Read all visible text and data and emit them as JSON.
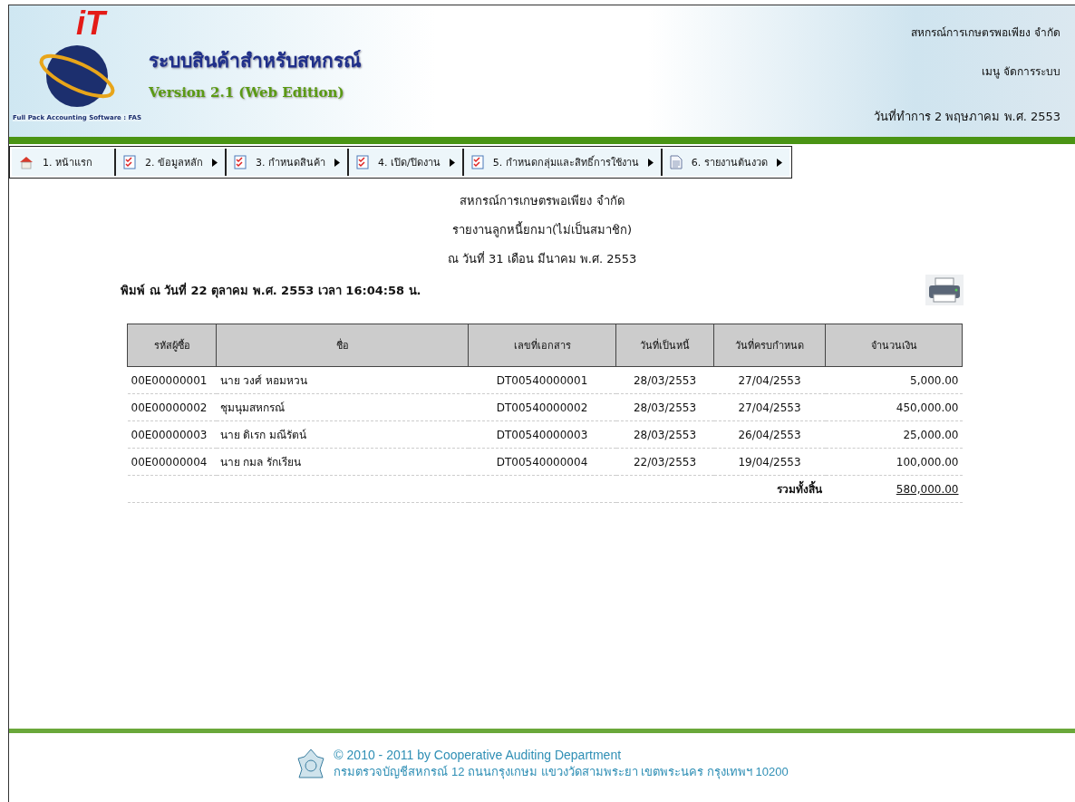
{
  "header": {
    "app_title": "ระบบสินค้าสำหรับสหกรณ์",
    "version": "Version 2.1 (Web Edition)",
    "logo_text": "iT",
    "logo_ring_text": "Full Pack Accounting Software : FAS",
    "org_name": "สหกรณ์การเกษตรพอเพียง จำกัด",
    "menu_name": "เมนู จัดการระบบ",
    "work_date": "วันที่ทำการ 2 พฤษภาคม พ.ศ. 2553"
  },
  "menu": [
    {
      "label": "1. หน้าแรก",
      "kind": "home",
      "submenu": false
    },
    {
      "label": "2. ข้อมูลหลัก",
      "kind": "check",
      "submenu": true
    },
    {
      "label": "3. กำหนดสินค้า",
      "kind": "check",
      "submenu": true
    },
    {
      "label": "4. เปิด/ปิดงาน",
      "kind": "check",
      "submenu": true
    },
    {
      "label": "5. กำหนดกลุ่มและสิทธิ์การใช้งาน",
      "kind": "check",
      "submenu": true
    },
    {
      "label": "6. รายงานต้นงวด",
      "kind": "doc",
      "submenu": true
    }
  ],
  "report": {
    "titles": [
      "สหกรณ์การเกษตรพอเพียง จำกัด",
      "รายงานลูกหนี้ยกมา(ไม่เป็นสมาชิก)",
      "ณ วันที่ 31 เดือน มีนาคม พ.ศ. 2553"
    ],
    "printed_at": "พิมพ์ ณ วันที่ 22 ตุลาคม พ.ศ. 2553 เวลา 16:04:58 น."
  },
  "table": {
    "columns": [
      "รหัสผู้ซื้อ",
      "ชื่อ",
      "เลขที่เอกสาร",
      "วันที่เป็นหนี้",
      "วันที่ครบกำหนด",
      "จำนวนเงิน"
    ],
    "rows": [
      [
        "00E00000001",
        "นาย วงศ์ หอมหวน",
        "DT00540000001",
        "28/03/2553",
        "27/04/2553",
        "5,000.00"
      ],
      [
        "00E00000002",
        "ชุมนุมสหกรณ์",
        "DT00540000002",
        "28/03/2553",
        "27/04/2553",
        "450,000.00"
      ],
      [
        "00E00000003",
        "นาย ดิเรก มณีรัตน์",
        "DT00540000003",
        "28/03/2553",
        "26/04/2553",
        "25,000.00"
      ],
      [
        "00E00000004",
        "นาย กมล รักเรียน",
        "DT00540000004",
        "22/03/2553",
        "19/04/2553",
        "100,000.00"
      ]
    ],
    "total_label": "รวมทั้งสิ้น",
    "total": "580,000.00"
  },
  "footer": {
    "copyright": "© 2010 - 2011  by Cooperative Auditing Department",
    "address": "กรมตรวจบัญชีสหกรณ์ 12 ถนนกรุงเกษม แขวงวัดสามพระยา เขตพระนคร กรุงเทพฯ 10200"
  }
}
